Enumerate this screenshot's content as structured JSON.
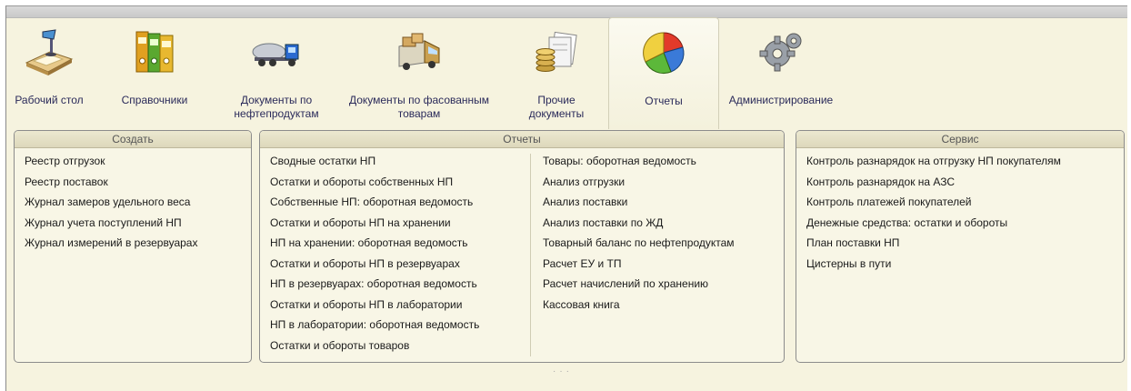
{
  "tabs": [
    {
      "label": "Рабочий стол",
      "icon": "desk-icon"
    },
    {
      "label": "Справочники",
      "icon": "binders-icon"
    },
    {
      "label": "Документы по нефтепродуктам",
      "icon": "tanker-truck-icon"
    },
    {
      "label": "Документы по фасованным товарам",
      "icon": "delivery-van-icon"
    },
    {
      "label": "Прочие документы",
      "icon": "coins-documents-icon"
    },
    {
      "label": "Отчеты",
      "icon": "pie-chart-icon",
      "active": true
    },
    {
      "label": "Администрирование",
      "icon": "gears-icon"
    }
  ],
  "panels": {
    "create": {
      "title": "Создать",
      "items": [
        "Реестр отгрузок",
        "Реестр поставок",
        "Журнал замеров удельного веса",
        "Журнал учета поступлений НП",
        "Журнал измерений в резервуарах"
      ]
    },
    "reports": {
      "title": "Отчеты",
      "col1": [
        "Сводные остатки НП",
        "Остатки и обороты собственных НП",
        "Собственные НП: оборотная ведомость",
        "Остатки и обороты НП на хранении",
        "НП на хранении: оборотная ведомость",
        "Остатки и обороты НП в резервуарах",
        "НП в резервуарах: оборотная ведомость",
        "Остатки и обороты НП в лаборатории",
        "НП в лаборатории: оборотная ведомость",
        "Остатки и обороты товаров"
      ],
      "col2": [
        "Товары: оборотная ведомость",
        "Анализ отгрузки",
        "Анализ поставки",
        "Анализ поставки по ЖД",
        "Товарный баланс по нефтепродуктам",
        "Расчет ЕУ и ТП",
        "Расчет начислений по хранению",
        "Кассовая книга"
      ]
    },
    "service": {
      "title": "Сервис",
      "items": [
        "Контроль разнарядок на отгрузку НП покупателям",
        "Контроль разнарядок на АЗС",
        "Контроль платежей покупателей",
        "Денежные средства: остатки и обороты",
        "План поставки НП",
        "Цистерны в пути"
      ]
    }
  },
  "colors": {
    "background": "#f6f3df",
    "panel_border": "#8c8c8c",
    "tab_label": "#2a2a5a"
  }
}
